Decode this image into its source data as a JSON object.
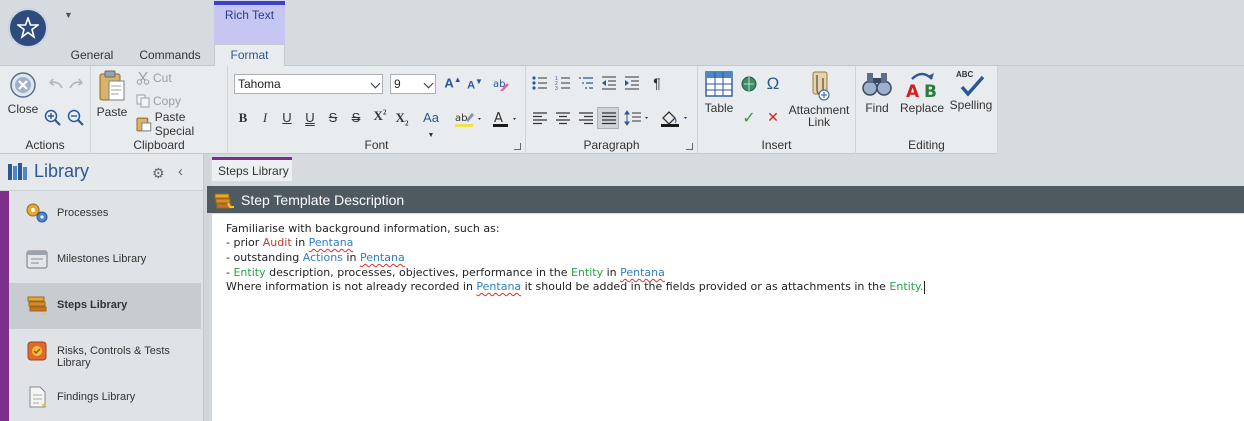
{
  "tabs": {
    "context_label": "Rich Text",
    "general": "General",
    "commands": "Commands",
    "format": "Format"
  },
  "ribbon": {
    "actions": {
      "label": "Actions",
      "close": "Close"
    },
    "clipboard": {
      "label": "Clipboard",
      "paste": "Paste",
      "cut": "Cut",
      "copy": "Copy",
      "paste_special": "Paste Special"
    },
    "font": {
      "label": "Font",
      "font_name": "Tahoma",
      "font_size": "9"
    },
    "paragraph": {
      "label": "Paragraph"
    },
    "insert": {
      "label": "Insert",
      "table": "Table",
      "attachment": "Attachment",
      "link": "Link"
    },
    "editing": {
      "label": "Editing",
      "find": "Find",
      "replace": "Replace",
      "spelling": "Spelling",
      "spelling_badge": "ABC"
    }
  },
  "sidebar": {
    "title": "Library",
    "items": [
      {
        "label": "Processes"
      },
      {
        "label": "Milestones Library"
      },
      {
        "label": "Steps Library"
      },
      {
        "label": "Risks, Controls & Tests Library"
      },
      {
        "label": "Findings Library"
      }
    ]
  },
  "document": {
    "tab": "Steps Library",
    "panel_title": "Step Template Description",
    "line1": "Familiarise with background information, such as:",
    "line2_a": "- prior ",
    "line2_b": "Audit",
    "line2_c": " in ",
    "line2_d": "Pentana",
    "line3_a": "- outstanding ",
    "line3_b": "Actions",
    "line3_c": " in ",
    "line3_d": "Pentana",
    "line4_a": "- ",
    "line4_b": "Entity",
    "line4_c": " description, processes, objectives, performance in the ",
    "line4_d": "Entity",
    "line4_e": " in ",
    "line4_f": "Pentana",
    "line5_a": "Where information is not already recorded in ",
    "line5_b": "Pentana",
    "line5_c": " it should be added in the fields provided or as attachments in the ",
    "line5_d": "Entity",
    "line5_e": "."
  },
  "colors": {
    "accent": "#7d2f8c",
    "header": "#4e5a60",
    "link_blue": "#2f7fc1",
    "entity_green": "#27a24a",
    "audit_red": "#c0392b"
  }
}
